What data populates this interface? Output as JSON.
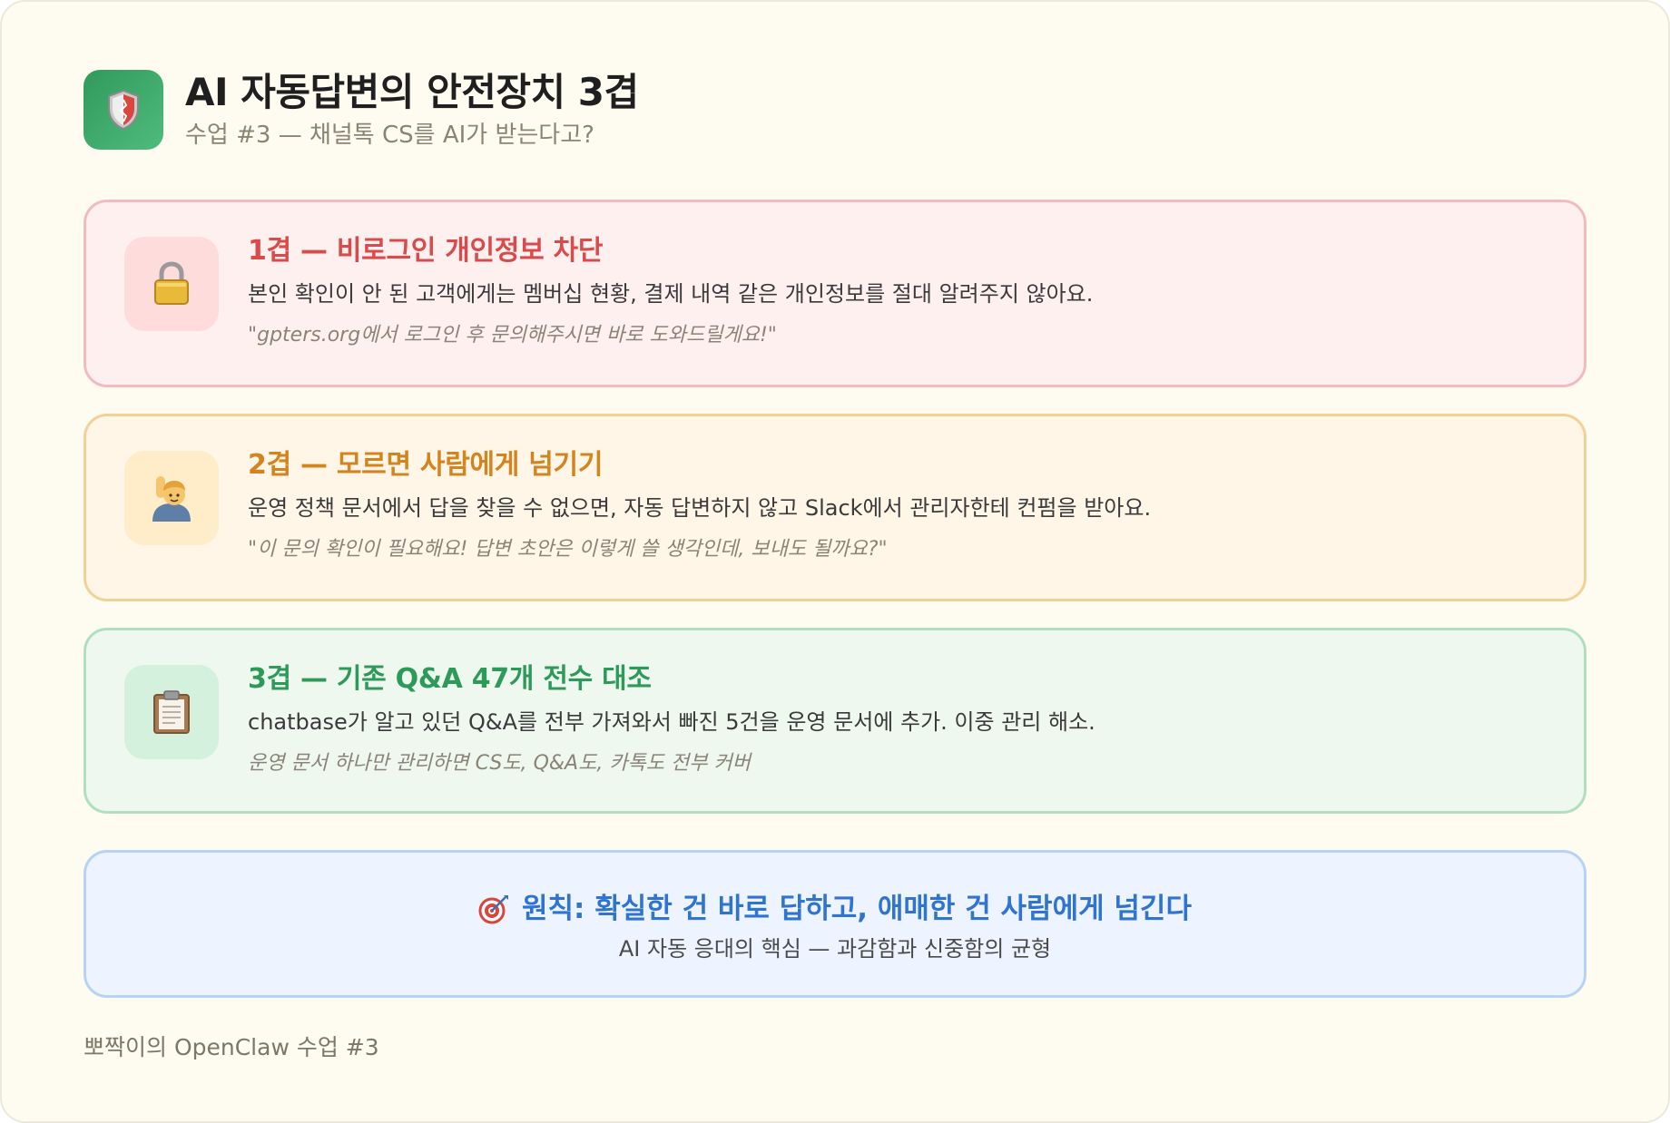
{
  "header": {
    "icon": "shield-icon",
    "title": "AI 자동답변의 안전장치 3겹",
    "subtitle": "수업 #3 — 채널톡 CS를 AI가 받는다고?"
  },
  "cards": [
    {
      "icon": "lock-icon",
      "title": "1겹 — 비로그인 개인정보 차단",
      "description": "본인 확인이 안 된 고객에게는 멤버십 현황, 결제 내역 같은 개인정보를 절대 알려주지 않아요.",
      "quote": "\"gpters.org에서 로그인 후 문의해주시면 바로 도와드릴게요!\"",
      "accent": "#d94b4b"
    },
    {
      "icon": "raising-hand-icon",
      "title": "2겹 — 모르면 사람에게 넘기기",
      "description": "운영 정책 문서에서 답을 찾을 수 없으면, 자동 답변하지 않고 Slack에서 관리자한테 컨펌을 받아요.",
      "quote": "\"이 문의 확인이 필요해요! 답변 초안은 이렇게 쓸 생각인데, 보내도 될까요?\"",
      "accent": "#d4841e"
    },
    {
      "icon": "clipboard-icon",
      "title": "3겹 — 기존 Q&A 47개 전수 대조",
      "description": "chatbase가 알고 있던 Q&A를 전부 가져와서 빠진 5건을 운영 문서에 추가. 이중 관리 해소.",
      "quote": "운영 문서 하나만 관리하면 CS도, Q&A도, 카톡도 전부 커버",
      "accent": "#2e9a5a"
    }
  ],
  "principle": {
    "icon": "target-icon",
    "title": "원칙: 확실한 건 바로 답하고, 애매한 건 사람에게 넘긴다",
    "subtitle": "AI 자동 응대의 핵심 — 과감함과 신중함의 균형",
    "accent": "#2f74d0"
  },
  "footer": {
    "text": "뽀짝이의 OpenClaw 수업 #3"
  }
}
